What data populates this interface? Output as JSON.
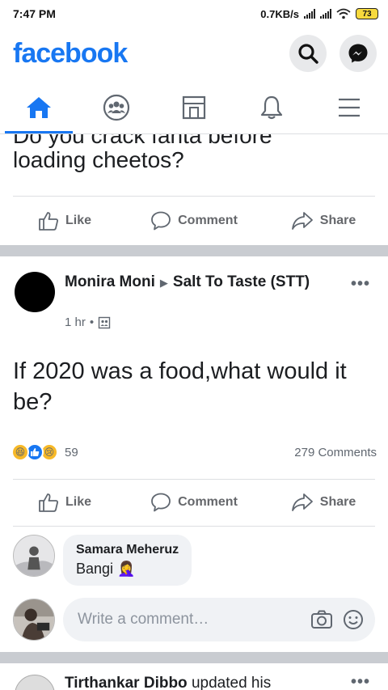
{
  "status": {
    "time": "7:47 PM",
    "speed": "0.7KB/s",
    "battery": "73"
  },
  "app": {
    "logo": "facebook",
    "search_icon": "search-icon",
    "messenger_icon": "messenger-icon"
  },
  "tabs": [
    {
      "name": "home",
      "icon": "home-icon",
      "active": true
    },
    {
      "name": "groups",
      "icon": "groups-icon",
      "active": false
    },
    {
      "name": "marketplace",
      "icon": "marketplace-icon",
      "active": false
    },
    {
      "name": "notifications",
      "icon": "bell-icon",
      "active": false
    },
    {
      "name": "menu",
      "icon": "menu-icon",
      "active": false
    }
  ],
  "post1": {
    "cut_text": "Do you crack fanta before",
    "text": "loading cheetos?",
    "actions": {
      "like": "Like",
      "comment": "Comment",
      "share": "Share"
    }
  },
  "post2": {
    "author": "Monira Moni",
    "group": "Salt To Taste (STT)",
    "time": "1 hr",
    "text": "If 2020 was a food,what would it be?",
    "reaction_count": "59",
    "comments_count": "279 Comments",
    "actions": {
      "like": "Like",
      "comment": "Comment",
      "share": "Share"
    },
    "comment": {
      "name": "Samara Meheruz",
      "text": "Bangi",
      "emoji": "🤦‍♀️"
    },
    "write_placeholder": "Write a comment…"
  },
  "post3": {
    "author": "Tirthankar Dibbo",
    "rest": "updated his"
  },
  "colors": {
    "brand": "#1877f2",
    "separator": "#c9ccd1"
  }
}
